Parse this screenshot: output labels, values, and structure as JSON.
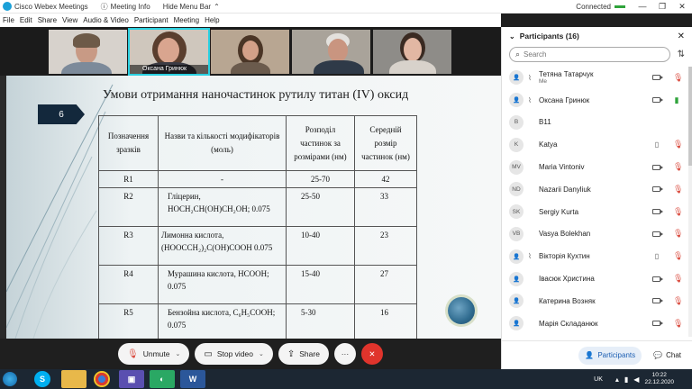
{
  "window": {
    "title": "Cisco Webex Meetings",
    "meeting_info": "Meeting Info",
    "hide_menu_bar": "Hide Menu Bar",
    "status": "Connected",
    "minimize": "—",
    "restore": "❐",
    "close": "✕"
  },
  "menu": [
    "File",
    "Edit",
    "Share",
    "View",
    "Audio & Video",
    "Participant",
    "Meeting",
    "Help"
  ],
  "video_tiles": [
    {
      "name": ""
    },
    {
      "name": "Оксана Гринюк",
      "active": true
    },
    {
      "name": ""
    },
    {
      "name": ""
    },
    {
      "name": ""
    }
  ],
  "slide": {
    "title": "Умови отримання наночастинок рутилу титан (IV)  оксид",
    "number": "6",
    "table": {
      "headers": [
        "Позначення зразків",
        "Назви та кількості модифікаторів (моль)",
        "Розподіл частинок за розмірами (нм)",
        "Середній розмір частинок (нм)"
      ],
      "rows": [
        {
          "id": "R1",
          "mod": "-",
          "dist": "25-70",
          "avg": "42"
        },
        {
          "id": "R2",
          "mod": "Гліцерин, HOCH₂CH(OH)CH₂OH; 0.075",
          "dist": "25-50",
          "avg": "33"
        },
        {
          "id": "R3",
          "mod": "Лимонна кислота, (HOOCCH₂)₂C(OH)COOH 0.075",
          "dist": "10-40",
          "avg": "23"
        },
        {
          "id": "R4",
          "mod": "Мурашина кислота, HCOOH; 0.075",
          "dist": "15-40",
          "avg": "27"
        },
        {
          "id": "R5",
          "mod": "Бензойна кислота, C₆H₅COOH; 0.075",
          "dist": "5-30",
          "avg": "16"
        }
      ]
    }
  },
  "controls": {
    "unmute": "Unmute",
    "stop_video": "Stop video",
    "share": "Share",
    "more": "···",
    "end": "✕"
  },
  "participants_panel": {
    "title": "Participants (16)",
    "search_placeholder": "Search",
    "participants": [
      {
        "initials": "",
        "name": "Тетяна Татарчук",
        "sub": "Me",
        "video": true,
        "audio": "muted"
      },
      {
        "initials": "",
        "name": "Оксана Гринюк",
        "sub": "",
        "video": true,
        "audio": "active"
      },
      {
        "initials": "B",
        "name": "B11",
        "sub": "",
        "video": false,
        "audio": "none"
      },
      {
        "initials": "K",
        "name": "Katya",
        "sub": "",
        "video": false,
        "audio": "muted"
      },
      {
        "initials": "MV",
        "name": "Maria Vintoniv",
        "sub": "",
        "video": true,
        "audio": "muted"
      },
      {
        "initials": "ND",
        "name": "Nazarii Danyliuk",
        "sub": "",
        "video": true,
        "audio": "muted"
      },
      {
        "initials": "SK",
        "name": "Sergiy Kurta",
        "sub": "",
        "video": true,
        "audio": "muted"
      },
      {
        "initials": "VB",
        "name": "Vasya Bolekhan",
        "sub": "",
        "video": true,
        "audio": "muted"
      },
      {
        "initials": "",
        "name": "Вікторія Кухтин",
        "sub": "",
        "video": false,
        "audio": "muted"
      },
      {
        "initials": "",
        "name": "Івасюк Христина",
        "sub": "",
        "video": true,
        "audio": "muted"
      },
      {
        "initials": "",
        "name": "Катерина Возняк",
        "sub": "",
        "video": true,
        "audio": "muted"
      },
      {
        "initials": "",
        "name": "Марія Складанюк",
        "sub": "",
        "video": true,
        "audio": "muted"
      }
    ],
    "participants_button": "Participants",
    "chat_button": "Chat"
  },
  "taskbar": {
    "language": "UK",
    "time": "10:22",
    "date": "22.12.2020"
  }
}
